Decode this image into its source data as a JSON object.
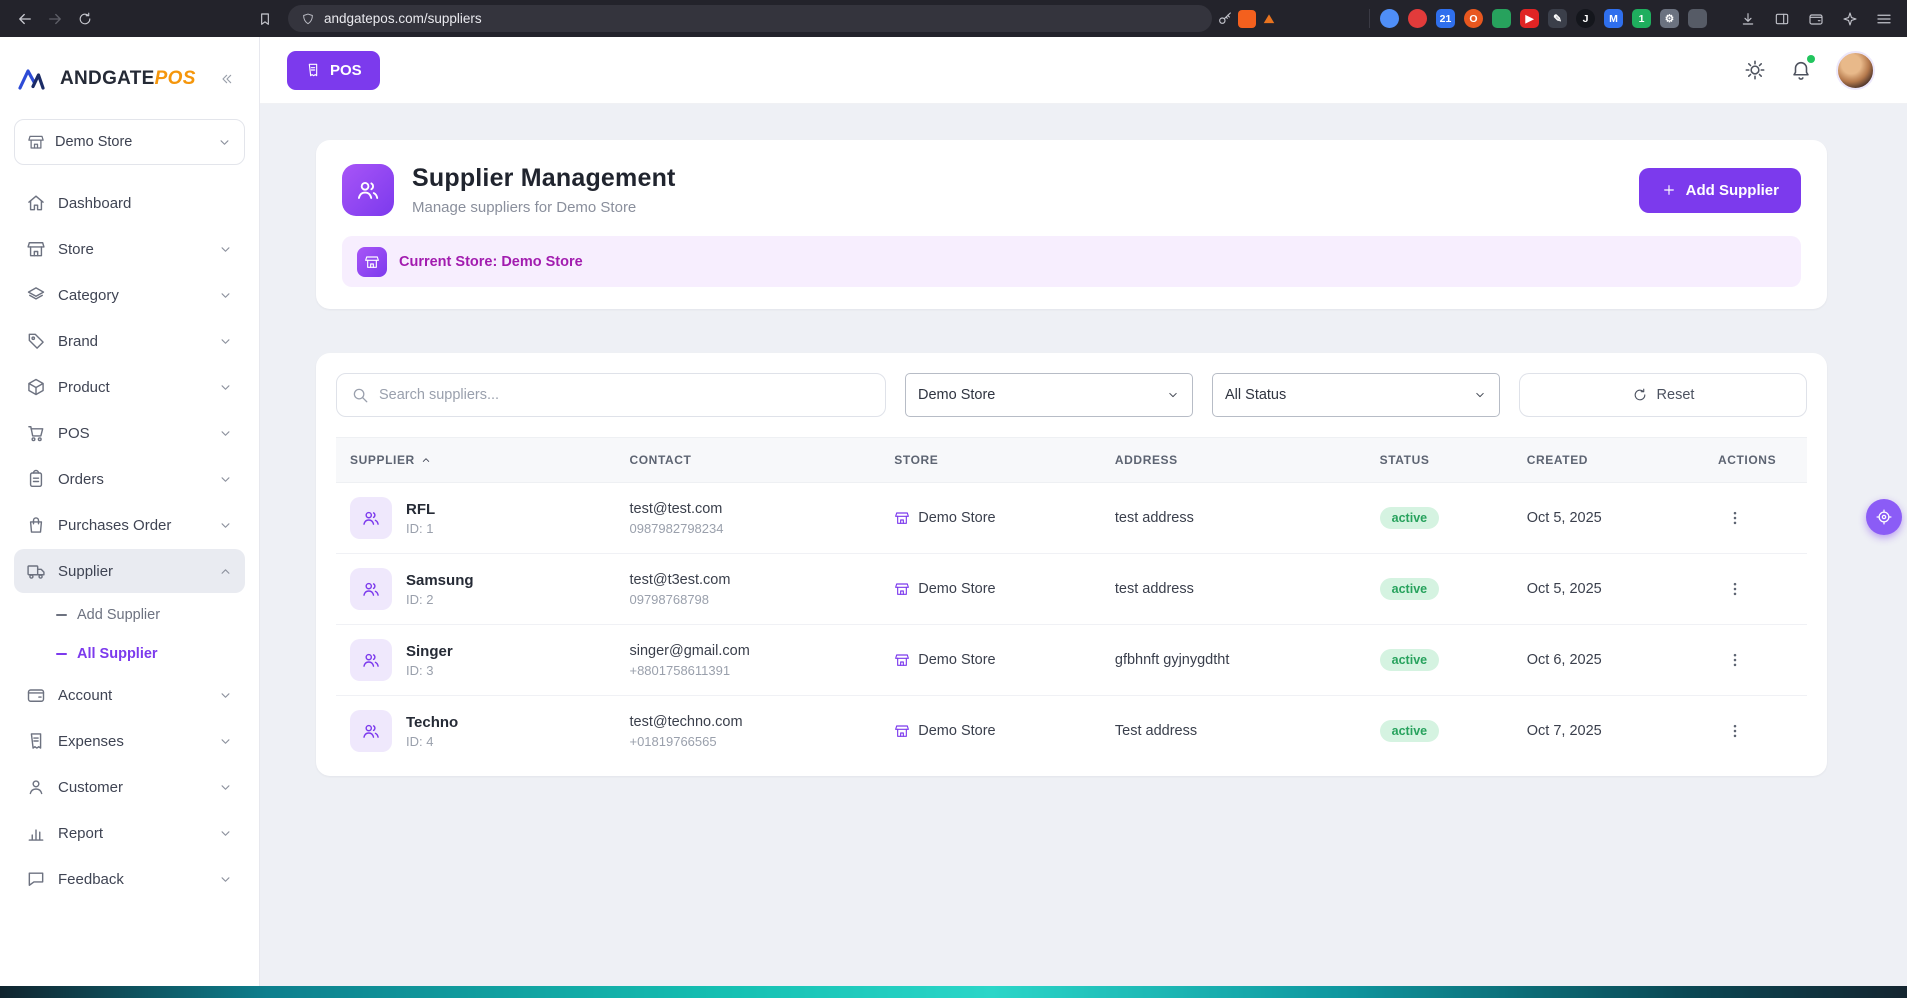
{
  "colors": {
    "accent": "#7c3aed",
    "accent_light": "#a855f7",
    "banner_text": "#a21caf",
    "banner_bg": "#f7eefe",
    "status_bg": "#d5f3e1",
    "status_text": "#27a25d",
    "logo_accent": "#f5960b"
  },
  "browser": {
    "url": "andgatepos.com/suppliers",
    "extensions": [
      {
        "name": "extension-icon-1",
        "bg": "#4f8ef7",
        "glyph": "",
        "round": true
      },
      {
        "name": "extension-icon-2",
        "bg": "#e23b3b",
        "glyph": "",
        "round": true
      },
      {
        "name": "shields-counter-icon",
        "bg": "#2f6fed",
        "glyph": "21",
        "round": false
      },
      {
        "name": "extension-icon-4",
        "bg": "#e8571f",
        "glyph": "O",
        "round": true
      },
      {
        "name": "extension-icon-5",
        "bg": "#27a25d",
        "glyph": "",
        "round": false
      },
      {
        "name": "video-extension-icon",
        "bg": "#e02424",
        "glyph": "▶",
        "round": false
      },
      {
        "name": "notes-extension-icon",
        "bg": "#3b3f4a",
        "glyph": "✎",
        "round": false
      },
      {
        "name": "extension-icon-8",
        "bg": "#14161c",
        "glyph": "J",
        "round": true
      },
      {
        "name": "extension-icon-9",
        "bg": "#2f6fed",
        "glyph": "M",
        "round": false
      },
      {
        "name": "extension-icon-10",
        "bg": "#1fae5e",
        "glyph": "1",
        "round": false
      },
      {
        "name": "puzzle-extensions-icon",
        "bg": "#6b7280",
        "glyph": "⚙",
        "round": false
      },
      {
        "name": "extension-icon-12",
        "bg": "#565b66",
        "glyph": "",
        "round": false
      }
    ]
  },
  "sidebar": {
    "brand": "ANDGATE",
    "brand_accent": "POS",
    "store_selector": "Demo Store",
    "items": [
      {
        "key": "dashboard",
        "label": "Dashboard",
        "icon": "home-icon",
        "chevron": false
      },
      {
        "key": "store",
        "label": "Store",
        "icon": "store-icon",
        "chevron": true
      },
      {
        "key": "category",
        "label": "Category",
        "icon": "layers-icon",
        "chevron": true
      },
      {
        "key": "brand",
        "label": "Brand",
        "icon": "tag-icon",
        "chevron": true
      },
      {
        "key": "product",
        "label": "Product",
        "icon": "box-icon",
        "chevron": true
      },
      {
        "key": "pos",
        "label": "POS",
        "icon": "cart-icon",
        "chevron": true
      },
      {
        "key": "orders",
        "label": "Orders",
        "icon": "clipboard-icon",
        "chevron": true
      },
      {
        "key": "purchases-order",
        "label": "Purchases Order",
        "icon": "bag-icon",
        "chevron": true
      },
      {
        "key": "supplier",
        "label": "Supplier",
        "icon": "truck-icon",
        "chevron": true,
        "expanded": true,
        "active": true,
        "children": [
          {
            "key": "add-supplier",
            "label": "Add Supplier",
            "active": false
          },
          {
            "key": "all-supplier",
            "label": "All Supplier",
            "active": true
          }
        ]
      },
      {
        "key": "account",
        "label": "Account",
        "icon": "wallet-icon",
        "chevron": true
      },
      {
        "key": "expenses",
        "label": "Expenses",
        "icon": "receipt-icon",
        "chevron": true
      },
      {
        "key": "customer",
        "label": "Customer",
        "icon": "user-icon",
        "chevron": true
      },
      {
        "key": "report",
        "label": "Report",
        "icon": "chart-icon",
        "chevron": true
      },
      {
        "key": "feedback",
        "label": "Feedback",
        "icon": "chat-icon",
        "chevron": true
      }
    ]
  },
  "topbar": {
    "pos_label": "POS"
  },
  "header": {
    "title": "Supplier Management",
    "subtitle": "Manage suppliers for Demo Store",
    "add_button_label": "Add Supplier",
    "current_store_banner": "Current Store: Demo Store"
  },
  "filters": {
    "search_placeholder": "Search suppliers...",
    "store_filter_value": "Demo Store",
    "status_filter_value": "All Status",
    "reset_label": "Reset"
  },
  "table": {
    "columns": [
      {
        "label": "SUPPLIER",
        "sorted": true
      },
      {
        "label": "CONTACT",
        "sorted": false
      },
      {
        "label": "STORE",
        "sorted": false
      },
      {
        "label": "ADDRESS",
        "sorted": false
      },
      {
        "label": "STATUS",
        "sorted": false
      },
      {
        "label": "CREATED",
        "sorted": false
      },
      {
        "label": "ACTIONS",
        "sorted": false
      }
    ],
    "rows": [
      {
        "name": "RFL",
        "id": "ID: 1",
        "email": "test@test.com",
        "phone": "0987982798234",
        "store": "Demo Store",
        "address": "test address",
        "status": "active",
        "created": "Oct 5, 2025"
      },
      {
        "name": "Samsung",
        "id": "ID: 2",
        "email": "test@t3est.com",
        "phone": "09798768798",
        "store": "Demo Store",
        "address": "test address",
        "status": "active",
        "created": "Oct 5, 2025"
      },
      {
        "name": "Singer",
        "id": "ID: 3",
        "email": "singer@gmail.com",
        "phone": "+8801758611391",
        "store": "Demo Store",
        "address": "gfbhnft gyjnygdtht",
        "status": "active",
        "created": "Oct 6, 2025"
      },
      {
        "name": "Techno",
        "id": "ID: 4",
        "email": "test@techno.com",
        "phone": "+01819766565",
        "store": "Demo Store",
        "address": "Test address",
        "status": "active",
        "created": "Oct 7, 2025"
      }
    ]
  }
}
